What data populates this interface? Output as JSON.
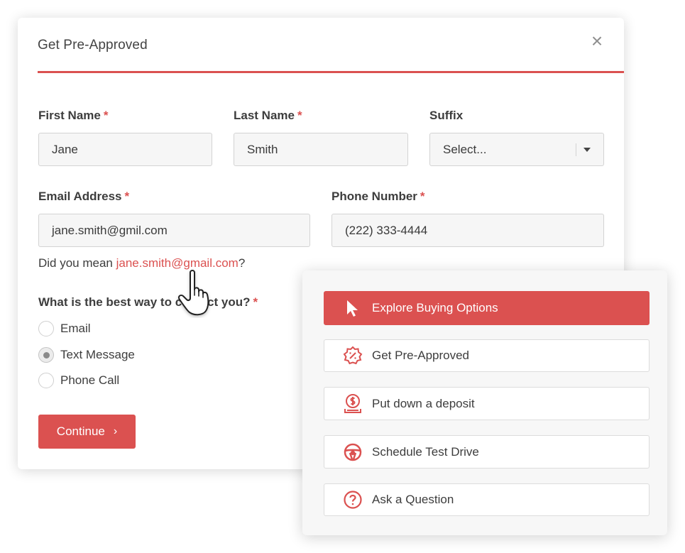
{
  "modal": {
    "title": "Get Pre-Approved",
    "close_label": "×"
  },
  "form": {
    "required_marker": "*",
    "first_name": {
      "label": "First Name",
      "value": "Jane"
    },
    "last_name": {
      "label": "Last Name",
      "value": "Smith"
    },
    "suffix": {
      "label": "Suffix",
      "value": "Select..."
    },
    "email": {
      "label": "Email Address",
      "value": "jane.smith@gmil.com"
    },
    "phone": {
      "label": "Phone Number",
      "value": "(222) 333-4444"
    },
    "suggestion": {
      "prefix": "Did you mean ",
      "link": "jane.smith@gmail.com",
      "suffix": "?"
    },
    "contact_question": "What is the best way to contact you?",
    "contact_options": [
      {
        "label": "Email",
        "selected": false
      },
      {
        "label": "Text Message",
        "selected": true
      },
      {
        "label": "Phone Call",
        "selected": false
      }
    ],
    "continue_label": "Continue",
    "continue_chevron": "›"
  },
  "actions_panel": {
    "items": [
      {
        "label": "Explore Buying Options",
        "icon": "cursor-arrow-icon",
        "active": true
      },
      {
        "label": "Get Pre-Approved",
        "icon": "percent-badge-icon",
        "active": false
      },
      {
        "label": "Put down a deposit",
        "icon": "dollar-deposit-icon",
        "active": false
      },
      {
        "label": "Schedule Test Drive",
        "icon": "steering-wheel-icon",
        "active": false
      },
      {
        "label": "Ask a Question",
        "icon": "question-circle-icon",
        "active": false
      }
    ]
  },
  "colors": {
    "accent": "#db5150",
    "input_bg": "#f6f6f6",
    "panel_bg": "#f7f7f7"
  }
}
